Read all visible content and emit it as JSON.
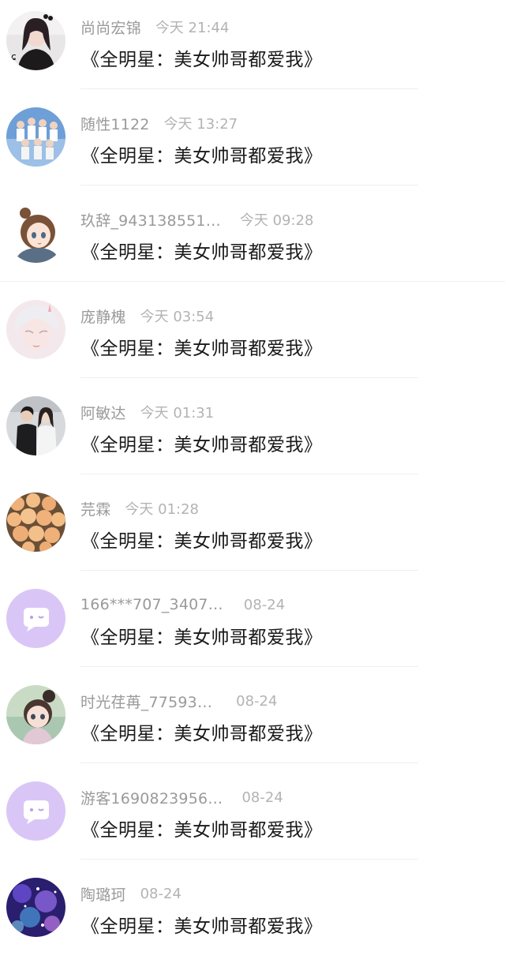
{
  "messages": [
    {
      "name": "尚尚宏锦",
      "time": "今天 21:44",
      "title": "《全明星：美女帅哥都爱我》",
      "avatar": "girl-photo-avatar"
    },
    {
      "name": "随性1122",
      "time": "今天 13:27",
      "title": "《全明星：美女帅哥都爱我》",
      "avatar": "group-photo-avatar"
    },
    {
      "name": "玖辞_943138551…",
      "time": "今天 09:28",
      "title": "《全明星：美女帅哥都爱我》",
      "avatar": "anime-girl-avatar"
    },
    {
      "name": "庞静槐",
      "time": "今天 03:54",
      "title": "《全明星：美女帅哥都爱我》",
      "avatar": "anime-boy-avatar"
    },
    {
      "name": "阿敏达",
      "time": "今天 01:31",
      "title": "《全明星：美女帅哥都爱我》",
      "avatar": "couple-photo-avatar"
    },
    {
      "name": "芫霖",
      "time": "今天 01:28",
      "title": "《全明星：美女帅哥都爱我》",
      "avatar": "roses-avatar"
    },
    {
      "name": "166***707_3407…",
      "time": "08-24",
      "title": "《全明星：美女帅哥都爱我》",
      "avatar": "default-chat-avatar"
    },
    {
      "name": "时光荏苒_77593…",
      "time": "08-24",
      "title": "《全明星：美女帅哥都爱我》",
      "avatar": "doll-avatar"
    },
    {
      "name": "游客1690823956…",
      "time": "08-24",
      "title": "《全明星：美女帅哥都爱我》",
      "avatar": "default-chat-avatar"
    },
    {
      "name": "陶璐珂",
      "time": "08-24",
      "title": "《全明星：美女帅哥都爱我》",
      "avatar": "galaxy-flowers-avatar"
    }
  ],
  "colors": {
    "name": "#9a9a9a",
    "time": "#b3b3b3",
    "title": "#1a1a1a",
    "divider": "#efefef",
    "default_avatar_bg": "#d9c6f7"
  }
}
